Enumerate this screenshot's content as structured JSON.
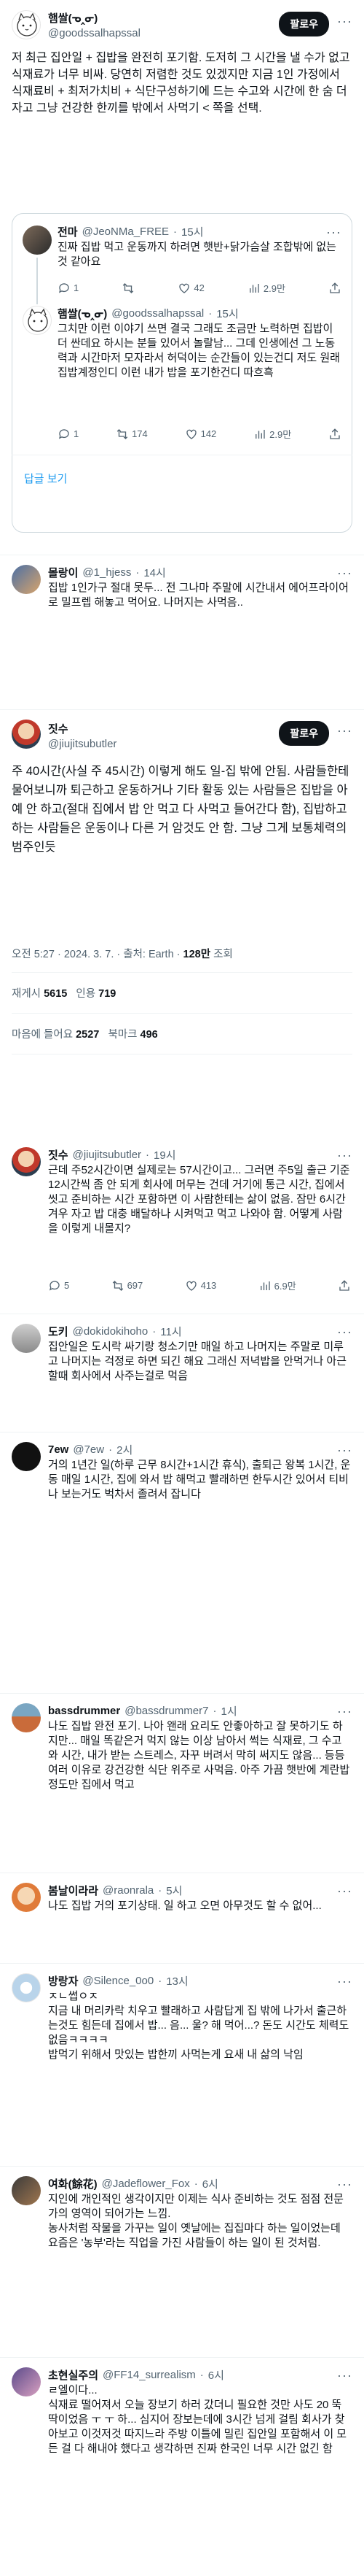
{
  "follow_label": "팔로우",
  "main": {
    "name": "햄쌀(ᓀ‸ᓂ)",
    "handle": "@goodssalhapssal",
    "text": "저 최근 집안일 + 집밥을 완전히 포기함. 도저히 그 시간을 낼 수가 없고 식재료가 너무 비싸. 당연히 저렴한 것도 있겠지만 지금 1인 가정에서 식재료비 + 최저가치비 + 식단구성하기에 드는 수고와 시간에 한 숨 더 자고 그냥 건강한 한끼를 밖에서 사먹기 < 쪽을 선택."
  },
  "quote1": {
    "name": "전마",
    "handle": "@JeoNMa_FREE",
    "time": "15시",
    "text": "진짜 집밥 먹고 운동까지 하려면 햇반+닭가슴살 조합밖에 없는 것 같아요",
    "stats": [
      "1",
      "42",
      "2.9만",
      ""
    ]
  },
  "quote2": {
    "name": "햄쌀(ᓀ‸ᓂ)",
    "handle": "@goodssalhapssal",
    "time": "15시",
    "text": "그치만 이런 이야기 쓰면 결국 그래도 조금만 노력하면 집밥이 더 싼데요 하시는 분들 있어서 놀랄남... 그데 인생에선 그 노동력과 시간마저 모자라서 허덕이는 순간들이 있는건디 저도 원래 집밥계정인디 이런 내가 밥을 포기한건디 따흐흑",
    "stats": [
      "1",
      "174",
      "142",
      "2.9만",
      ""
    ]
  },
  "show_replies": "답글 보기",
  "r1": {
    "name": "몰랑이",
    "handle": "@1_hjess",
    "time": "14시",
    "text": "집밥 1인가구 절대 못두... 전 그나마 주말에 시간내서 에어프라이어로 밀프렙 해놓고 먹어요. 나머지는 사먹음.."
  },
  "thread": {
    "name": "짓수",
    "handle": "@jiujitsubutler",
    "text": "주 40시간(사실 주 45시간) 이렇게 해도 일-집 밖에 안됨. 사람들한테 물어보니까 퇴근하고 운동하거나 기타 활동 있는 사람들은 집밥을 아예 안 하고(절대 집에서 밥 안 먹고 다 사먹고 들어간다 함), 집밥하고 하는 사람들은 운동이나 다른 거 암것도 안 함. 그냥 그게 보통체력의 범주인듯",
    "time": "오전 5:27 · 2024. 3. 7.",
    "client": "출처: Earth",
    "views": "128만",
    "views_label": "조회",
    "reposts": "5615",
    "reposts_label": "재게시",
    "quotes": "719",
    "quotes_label": "인용",
    "likes": "2527",
    "likes_label": "마음에 들어요",
    "bookmarks": "496",
    "bookmarks_label": "북마크"
  },
  "r2": {
    "name": "짓수",
    "handle": "@jiujitsubutler",
    "time": "19시",
    "text": "근데 주52시간이면 실제로는 57시간이고... 그러면 주5일 출근 기준 12시간씩 좀 안 되게 회사에 머무는 건데 거기에 통근 시간, 집에서 씻고 준비하는 시간 포함하면 이 사람한테는 삶이 없음. 잠만 6시간 겨우 자고 밥 대충 배달하나 시켜먹고 먹고 나와야 함. 어떻게 사람을 이렇게 내몰지?",
    "stats": [
      "5",
      "697",
      "413",
      "6.9만",
      ""
    ]
  },
  "r3": {
    "name": "도키",
    "handle": "@dokidokihoho",
    "time": "11시",
    "text": "집안일은 도시락 싸기랑 청소기만 매일 하고 나머지는 주말로 미루고 나머지는 걱정로 하면 되긴 해요 그래신 저녁밥을 안먹거나 아근할때 회사에서 사주는걸로 먹음"
  },
  "r4": {
    "name": "7ew",
    "handle": "@7ew",
    "time": "2시",
    "text": "거의 1년간 일(하루 근무 8시간+1시간 휴식), 출퇴근 왕복 1시간, 운동 매일 1시간, 집에 와서 밥 해먹고 빨래하면 한두시간 있어서 티비나 보는거도 벅차서 졸려서 잡니다"
  },
  "r5": {
    "name": "bassdrummer",
    "handle": "@bassdrummer7",
    "time": "1시",
    "text": "나도 집밥 완전 포기. 나아 왠래 요리도 안좋아하고 잘 못하기도 하지만... 매일 똑같은거 먹지 않는 이상 남아서 썩는 식재료, 그 수고와 시간, 내가 받는 스트레스, 자꾸 버려서 막히 써지도 않음... 등등 여러 이유로 강건강한 식단 위주로 사먹음. 아주 가끔 햇반에 계란밥정도만 집에서 먹고"
  },
  "r6": {
    "name": "봄날이라라",
    "handle": "@raonrala",
    "time": "5시",
    "text": "나도 집밥 거의 포기상태. 일 하고 오면 아무것도 할 수 없어..."
  },
  "r7": {
    "name": "방랑자",
    "handle": "@Silence_0o0",
    "time": "13시",
    "text": "ㅈㄴ썹ㅇㅈ\n지금 내 머리카락 치우고 빨래하고 사람답게 집 밖에 나가서 출근하는것도 힘든데 집에서 밥... 음... 울? 해 먹어...? 돈도 시간도 체력도 없음ㅋㅋㅋㅋ\n밥먹기 위해서 맛있는 밥한끼 사먹는게 요새 내 삶의 낙임"
  },
  "r8": {
    "name": "여화(餘花)",
    "handle": "@Jadeflower_Fox",
    "time": "6시",
    "text": "지인에 개인적인 생각이지만 이제는 식사 준비하는 것도 점점 전문가의 영역이 되어가는 느낌.\n농사처럼 작물을 가꾸는 일이 옛날에는 집집마다 하는 일이었는데 요즘은 '농부'라는 직업을 가진 사람들이 하는 일이 된 것처럼."
  },
  "r9": {
    "name": "초현실주의",
    "handle": "@FF14_surrealism",
    "time": "6시",
    "text": "ㄹ엘이다...\n식재료 떨어져서 오늘 장보기 하러 갔더니 필요한 것만 사도 20 뚝딱이었음 ㅜ ㅜ 하... 심지어 장보는데에 3시간 넘게 걸림 회사가 찾아보고 이것저것 따지느라 주방 이틀에 밀린 집안일 포함해서 이 모든 걸 다 해내야 했다고 생각하면 진짜 한국인 너무 시간 없긴 함"
  }
}
